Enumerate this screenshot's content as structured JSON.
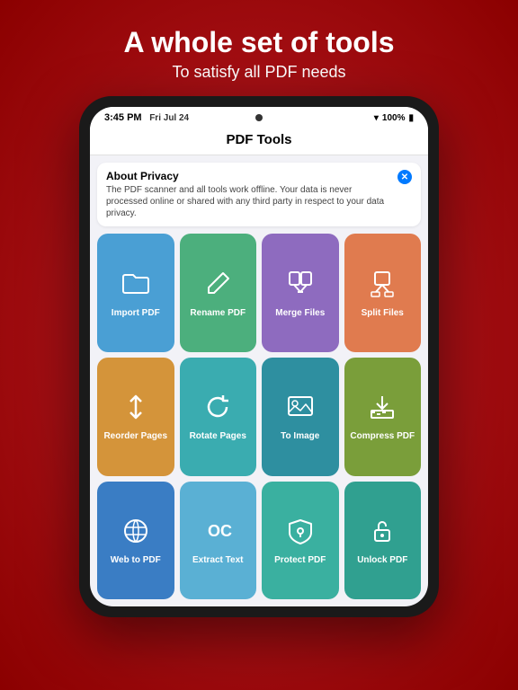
{
  "header": {
    "title": "A whole set of tools",
    "subtitle": "To satisfy all PDF needs"
  },
  "statusBar": {
    "time": "3:45 PM",
    "date": "Fri Jul 24",
    "wifi": "WiFi",
    "battery": "100%"
  },
  "navBar": {
    "title": "PDF Tools"
  },
  "privacyBanner": {
    "title": "About Privacy",
    "text": "The PDF scanner and all tools work offline. Your data is never processed online or shared with any third party in respect to your data privacy."
  },
  "tools": [
    {
      "id": "import-pdf",
      "label": "Import PDF",
      "color": "btn-blue",
      "icon": "folder"
    },
    {
      "id": "rename-pdf",
      "label": "Rename PDF",
      "color": "btn-green",
      "icon": "pencil"
    },
    {
      "id": "merge-files",
      "label": "Merge Files",
      "color": "btn-purple",
      "icon": "merge"
    },
    {
      "id": "split-files",
      "label": "Split Files",
      "color": "btn-orange",
      "icon": "split"
    },
    {
      "id": "reorder-pages",
      "label": "Reorder Pages",
      "color": "btn-yellow-orange",
      "icon": "reorder"
    },
    {
      "id": "rotate-pages",
      "label": "Rotate Pages",
      "color": "btn-teal",
      "icon": "rotate"
    },
    {
      "id": "to-image",
      "label": "To Image",
      "color": "btn-dark-teal",
      "icon": "image"
    },
    {
      "id": "compress-pdf",
      "label": "Compress PDF",
      "color": "btn-olive",
      "icon": "compress"
    },
    {
      "id": "web-to-pdf",
      "label": "Web to PDF",
      "color": "btn-blue2",
      "icon": "globe"
    },
    {
      "id": "extract-text",
      "label": "Extract Text",
      "color": "btn-light-blue",
      "icon": "ocr"
    },
    {
      "id": "protect-pdf",
      "label": "Protect PDF",
      "color": "btn-teal2",
      "icon": "shield"
    },
    {
      "id": "unlock-pdf",
      "label": "Unlock PDF",
      "color": "btn-teal3",
      "icon": "unlock"
    }
  ]
}
